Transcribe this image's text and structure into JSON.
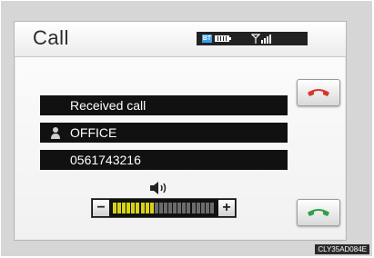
{
  "header": {
    "title": "Call"
  },
  "status_icons": [
    "bluetooth-icon",
    "battery-icon",
    "signal-strength-icon"
  ],
  "call": {
    "status": "Received call",
    "name": "OFFICE",
    "number": "0561743216"
  },
  "buttons": {
    "end_call_icon": "phone-hangup-icon",
    "answer_call_icon": "phone-answer-icon"
  },
  "volume": {
    "icon": "speaker-icon",
    "minus_label": "−",
    "plus_label": "+",
    "level": 9,
    "max": 22
  },
  "colors": {
    "end_call": "#d9362b",
    "answer_call": "#2fa04a",
    "volume_active": "#d8d21a",
    "volume_inactive": "#6b6b6b"
  },
  "caption": "CLY35AD084E"
}
